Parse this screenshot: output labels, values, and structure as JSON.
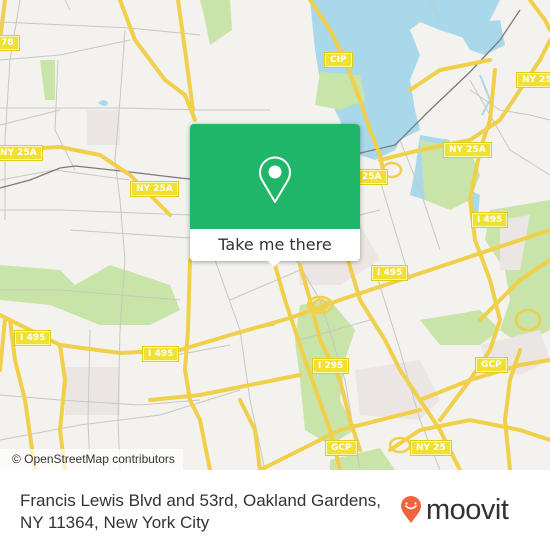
{
  "map": {
    "colors": {
      "background": "#f3f2ee",
      "water": "#a9d8ea",
      "park": "#c9e4a9",
      "road_major": "#f5e06a",
      "road_minor": "#c9c7c2",
      "rail": "#7a7a7a",
      "shield": "#f0e032"
    },
    "shields": [
      {
        "label": "78"
      },
      {
        "label": "CIP"
      },
      {
        "label": "NY 25"
      },
      {
        "label": "NY 25A"
      },
      {
        "label": "NY 25A"
      },
      {
        "label": "25A"
      },
      {
        "label": "NY 25A"
      },
      {
        "label": "I 495"
      },
      {
        "label": "I 495"
      },
      {
        "label": "I 495"
      },
      {
        "label": "I 495"
      },
      {
        "label": "I 295"
      },
      {
        "label": "GCP"
      },
      {
        "label": "GCP"
      },
      {
        "label": "NY 25"
      }
    ],
    "attribution": "© OpenStreetMap contributors"
  },
  "popup": {
    "icon": "map-pin-icon",
    "button_label": "Take me there",
    "accent": "#1fb66a"
  },
  "footer": {
    "address": "Francis Lewis Blvd and 53rd, Oakland Gardens, NY 11364, New York City",
    "brand": "moovit",
    "brand_color": "#f0633c"
  }
}
